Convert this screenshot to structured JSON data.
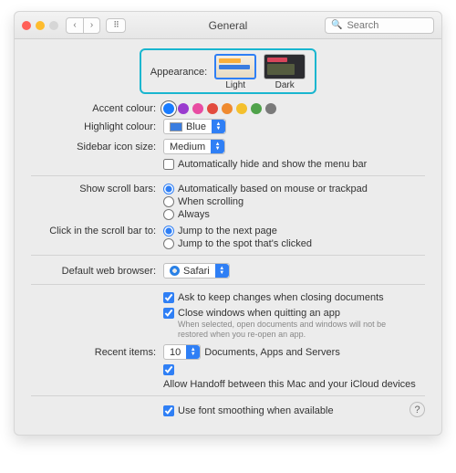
{
  "window": {
    "title": "General",
    "search_placeholder": "Search"
  },
  "appearance": {
    "label": "Appearance:",
    "light": "Light",
    "dark": "Dark"
  },
  "accent": {
    "label": "Accent colour:"
  },
  "highlight": {
    "label": "Highlight colour:",
    "value": "Blue"
  },
  "sidebar": {
    "label": "Sidebar icon size:",
    "value": "Medium"
  },
  "menubar_hide": "Automatically hide and show the menu bar",
  "scroll": {
    "label": "Show scroll bars:",
    "opt1": "Automatically based on mouse or trackpad",
    "opt2": "When scrolling",
    "opt3": "Always"
  },
  "click_sb": {
    "label": "Click in the scroll bar to:",
    "opt1": "Jump to the next page",
    "opt2": "Jump to the spot that's clicked"
  },
  "browser": {
    "label": "Default web browser:",
    "value": "Safari"
  },
  "ask_keep": "Ask to keep changes when closing documents",
  "close_win": "Close windows when quitting an app",
  "close_win_sub": "When selected, open documents and windows will not be restored when you re-open an app.",
  "recent": {
    "label": "Recent items:",
    "value": "10",
    "suffix": "Documents, Apps and Servers"
  },
  "handoff": "Allow Handoff between this Mac and your iCloud devices",
  "font_smooth": "Use font smoothing when available"
}
